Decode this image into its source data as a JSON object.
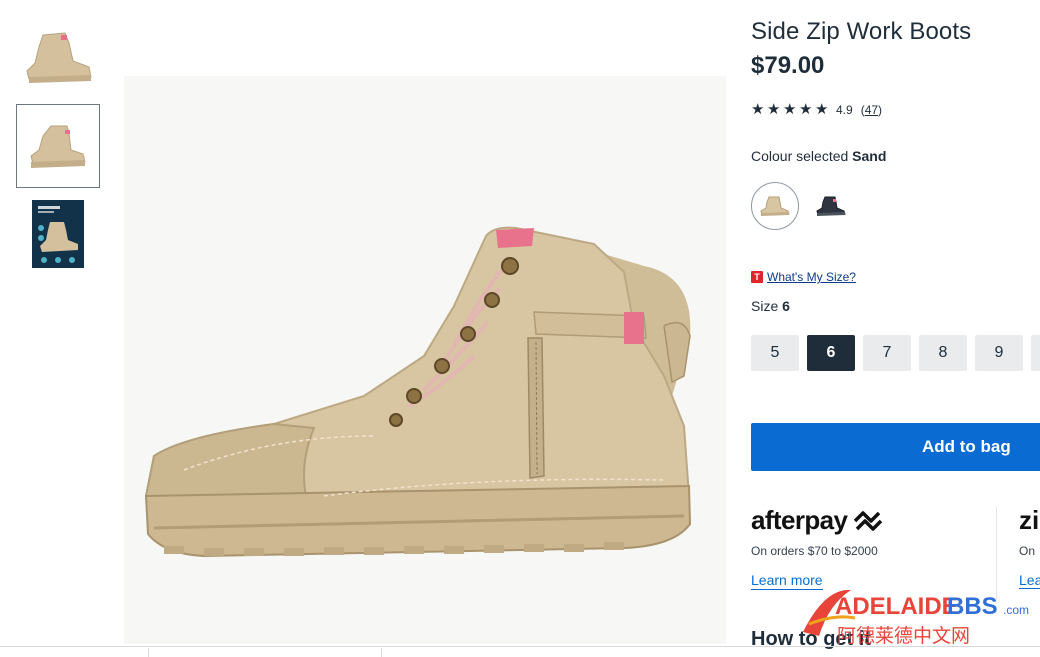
{
  "product": {
    "title": "Side Zip Work Boots",
    "price": "$79.00",
    "rating": {
      "stars": 5,
      "score": "4.9",
      "count": "47"
    }
  },
  "thumbnails": [
    {
      "name": "boot-side-view",
      "selected": false
    },
    {
      "name": "boot-front-view",
      "selected": true
    },
    {
      "name": "boot-feature-infographic",
      "selected": false
    }
  ],
  "colour": {
    "label": "Colour selected",
    "selected": "Sand",
    "swatches": [
      {
        "name": "Sand",
        "color": "#d8c5a2",
        "selected": true
      },
      {
        "name": "Black",
        "color": "#2e3540",
        "selected": false
      }
    ]
  },
  "size_guide": {
    "badge": "T",
    "link": "What's My Size?"
  },
  "size": {
    "label": "Size",
    "selected": "6",
    "options": [
      "5",
      "6",
      "7",
      "8",
      "9"
    ]
  },
  "add_to_bag": "Add to bag",
  "afterpay": {
    "logo": "afterpay",
    "note": "On orders $70 to $2000",
    "learn": "Learn more"
  },
  "zip": {
    "logo": "zi",
    "note": "On",
    "learn": "Lea"
  },
  "how_to": "How to get it",
  "watermark": {
    "brand": "ADELAIDE",
    "brand2": "BBS",
    "domain": ".com",
    "cn": "阿德莱德中文网"
  },
  "colors": {
    "text": "#1f2d3a",
    "accent_blue": "#0a6cd2",
    "sand": "#d8c5a2",
    "pink": "#e8728c"
  }
}
